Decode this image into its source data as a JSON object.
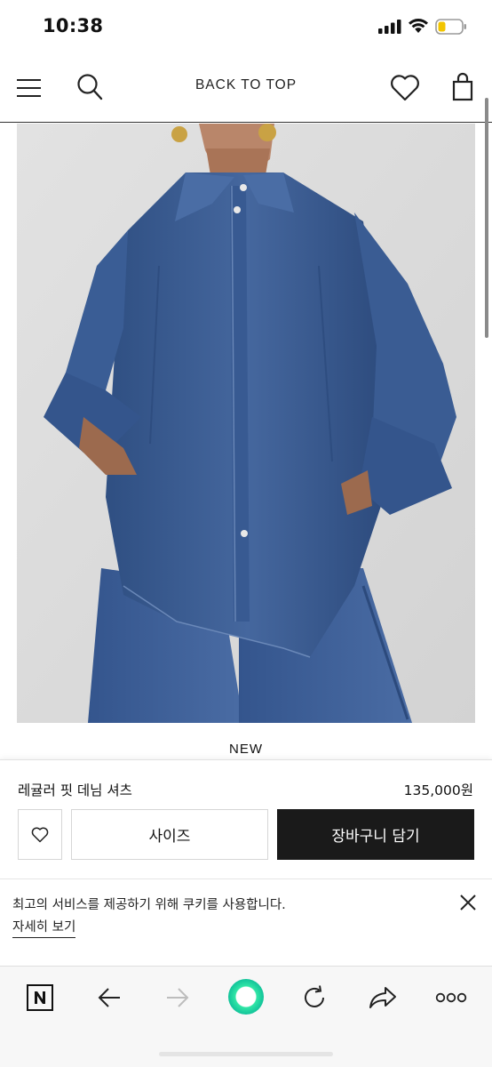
{
  "status_bar": {
    "time": "10:38"
  },
  "header": {
    "back_to_top": "BACK TO TOP"
  },
  "product": {
    "badge": "NEW",
    "name": "레귤러 핏 데님 셔츠",
    "price": "135,000원",
    "size_label": "사이즈",
    "cart_label": "장바구니 담기"
  },
  "cookie": {
    "message": "최고의 서비스를 제공하기 위해 쿠키를 사용합니다.",
    "link": "자세히 보기"
  },
  "colors": {
    "cart_button": "#1a1a1a",
    "denim": "#3d5f94",
    "naver_green": "#21d6a0",
    "battery": "#f2c500"
  }
}
